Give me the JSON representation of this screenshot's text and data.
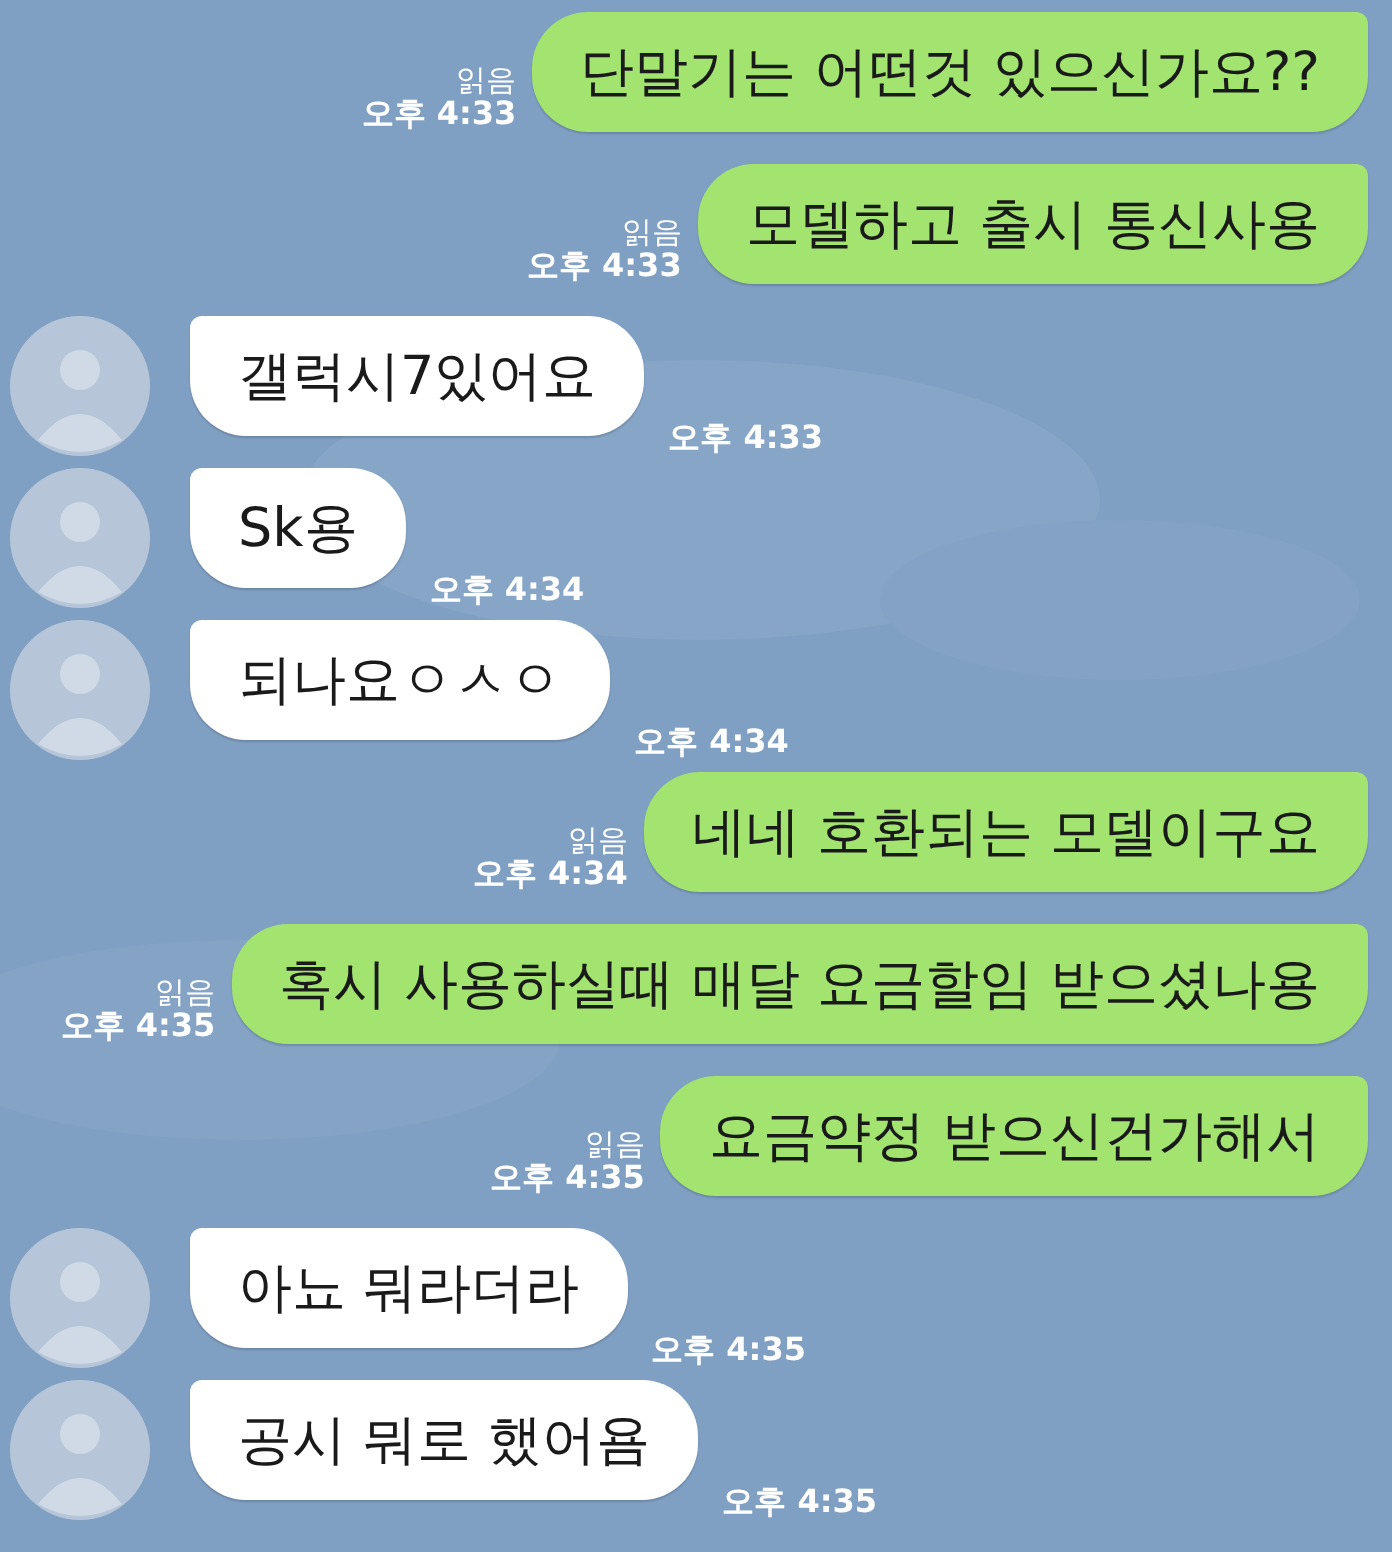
{
  "messages": [
    {
      "kind": "sent",
      "text": "단말기는 어떤것 있으신가요??",
      "read": "읽음",
      "time": "오후 4:33"
    },
    {
      "kind": "sent",
      "text": "모델하고 출시 통신사용",
      "read": "읽음",
      "time": "오후 4:33"
    },
    {
      "kind": "received",
      "text": "갤럭시7있어요",
      "time": "오후 4:33"
    },
    {
      "kind": "received",
      "text": "Sk용",
      "time": "오후 4:34"
    },
    {
      "kind": "received",
      "text": "되나요ㅇㅅㅇ",
      "time": "오후 4:34"
    },
    {
      "kind": "sent",
      "text": "네네 호환되는 모델이구요",
      "read": "읽음",
      "time": "오후 4:34"
    },
    {
      "kind": "sent",
      "text": "혹시 사용하실때 매달 요금할임 받으셨나용",
      "read": "읽음",
      "time": "오후 4:35"
    },
    {
      "kind": "sent",
      "text": "요금약정 받으신건가해서",
      "read": "읽음",
      "time": "오후 4:35"
    },
    {
      "kind": "received",
      "text": "아뇨 뭐라더라",
      "time": "오후 4:35"
    },
    {
      "kind": "received",
      "text": "공시 뭐로 했어욤",
      "time": "오후 4:35"
    }
  ]
}
